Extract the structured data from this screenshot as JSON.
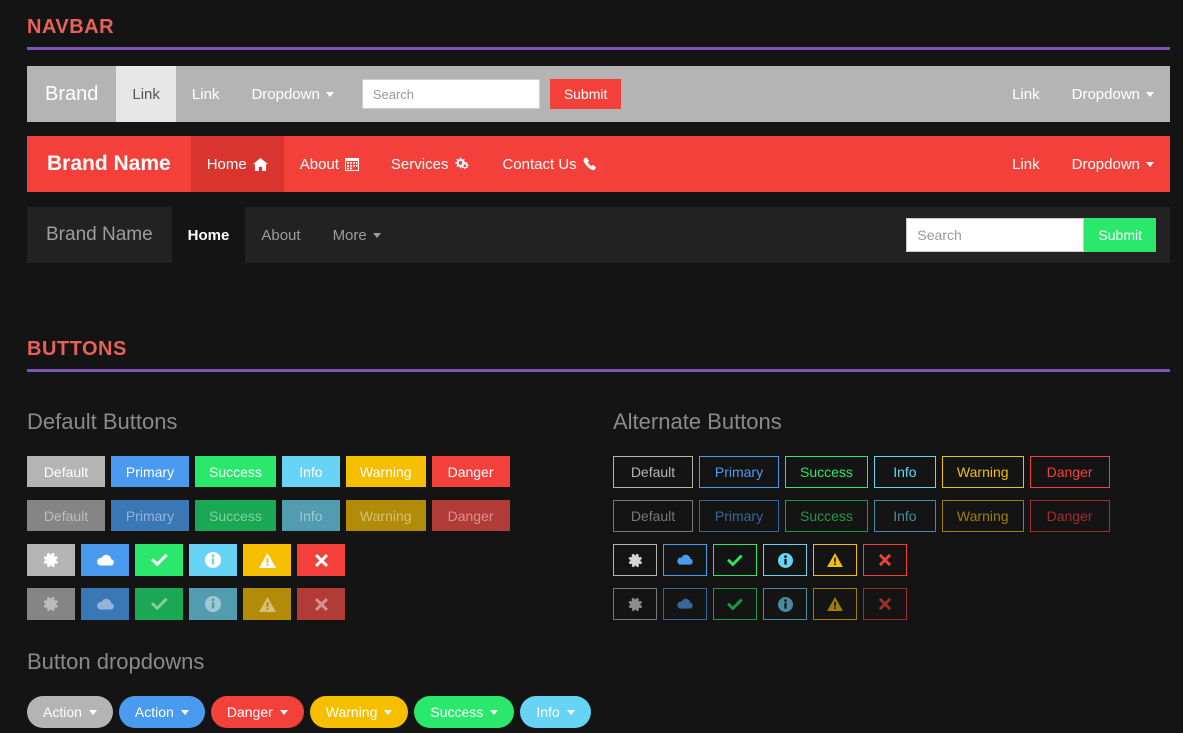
{
  "sections": {
    "navbar": {
      "title": "NAVBAR",
      "rule_color": "#7b55b5",
      "title_color": "#e8615a"
    },
    "buttons": {
      "title": "BUTTONS",
      "rule_color": "#7b55b5",
      "title_color": "#e8615a"
    }
  },
  "navbars": [
    {
      "style": "gray",
      "brand": "Brand",
      "left_items": [
        {
          "label": "Link",
          "active": true,
          "caret": false
        },
        {
          "label": "Link",
          "active": false,
          "caret": false
        },
        {
          "label": "Dropdown",
          "active": false,
          "caret": true
        }
      ],
      "search": {
        "placeholder": "Search",
        "value": ""
      },
      "submit_label": "Submit",
      "submit_color": "#f3403a",
      "right_items": [
        {
          "label": "Link",
          "caret": false
        },
        {
          "label": "Dropdown",
          "caret": true
        }
      ]
    },
    {
      "style": "red",
      "brand": "Brand Name",
      "left_items": [
        {
          "label": "Home",
          "active": true,
          "icon": "home-icon"
        },
        {
          "label": "About",
          "active": false,
          "icon": "calendar-icon"
        },
        {
          "label": "Services",
          "active": false,
          "icon": "gears-icon"
        },
        {
          "label": "Contact Us",
          "active": false,
          "icon": "phone-icon"
        }
      ],
      "right_items": [
        {
          "label": "Link",
          "caret": false
        },
        {
          "label": "Dropdown",
          "caret": true
        }
      ]
    },
    {
      "style": "dark",
      "brand": "Brand Name",
      "left_items": [
        {
          "label": "Home",
          "active": true,
          "caret": false
        },
        {
          "label": "About",
          "active": false,
          "caret": false
        },
        {
          "label": "More",
          "active": false,
          "caret": true
        }
      ],
      "search": {
        "placeholder": "Search",
        "value": ""
      },
      "submit_label": "Submit",
      "submit_color": "#2ae86b"
    }
  ],
  "buttons": {
    "default_heading": "Default Buttons",
    "alternate_heading": "Alternate Buttons",
    "dropdown_heading": "Button dropdowns",
    "solid_row": [
      {
        "label": "Default",
        "bg": "#b4b4b4"
      },
      {
        "label": "Primary",
        "bg": "#4a9bf0"
      },
      {
        "label": "Success",
        "bg": "#2ae86b"
      },
      {
        "label": "Info",
        "bg": "#68d4f5"
      },
      {
        "label": "Warning",
        "bg": "#f5bf00"
      },
      {
        "label": "Danger",
        "bg": "#f3403a"
      }
    ],
    "solid_row_muted": [
      {
        "label": "Default",
        "bg": "#858585"
      },
      {
        "label": "Primary",
        "bg": "#3a77b5"
      },
      {
        "label": "Success",
        "bg": "#1aa854"
      },
      {
        "label": "Info",
        "bg": "#529cb0"
      },
      {
        "label": "Warning",
        "bg": "#b28c08"
      },
      {
        "label": "Danger",
        "bg": "#b13b37"
      }
    ],
    "icon_row": [
      {
        "icon": "gear-icon",
        "bg": "#b4b4b4"
      },
      {
        "icon": "cloud-icon",
        "bg": "#4a9bf0"
      },
      {
        "icon": "check-icon",
        "bg": "#2ae86b"
      },
      {
        "icon": "info-icon",
        "bg": "#68d4f5"
      },
      {
        "icon": "warning-icon",
        "bg": "#f5bf00"
      },
      {
        "icon": "close-icon",
        "bg": "#f3403a"
      }
    ],
    "icon_row_muted": [
      {
        "icon": "gear-icon",
        "bg": "#858585"
      },
      {
        "icon": "cloud-icon",
        "bg": "#3a77b5"
      },
      {
        "icon": "check-icon",
        "bg": "#1aa854"
      },
      {
        "icon": "info-icon",
        "bg": "#529cb0"
      },
      {
        "icon": "warning-icon",
        "bg": "#b28c08"
      },
      {
        "icon": "close-icon",
        "bg": "#b13b37"
      }
    ],
    "outline_row": [
      {
        "label": "Default",
        "color": "#b4b4b4"
      },
      {
        "label": "Primary",
        "color": "#4a9bf0"
      },
      {
        "label": "Success",
        "color": "#2ae86b"
      },
      {
        "label": "Info",
        "color": "#68d4f5"
      },
      {
        "label": "Warning",
        "color": "#f5bf00"
      },
      {
        "label": "Danger",
        "color": "#f3403a"
      }
    ],
    "outline_row_muted": [
      {
        "label": "Default",
        "color": "#b4b4b4"
      },
      {
        "label": "Primary",
        "color": "#4a9bf0"
      },
      {
        "label": "Success",
        "color": "#2ae86b"
      },
      {
        "label": "Info",
        "color": "#68d4f5"
      },
      {
        "label": "Warning",
        "color": "#f5bf00"
      },
      {
        "label": "Danger",
        "color": "#f3403a"
      }
    ],
    "outline_icon_row": [
      {
        "icon": "gear-icon",
        "color": "#b4b4b4"
      },
      {
        "icon": "cloud-icon",
        "color": "#4a9bf0"
      },
      {
        "icon": "check-icon",
        "color": "#2ae86b"
      },
      {
        "icon": "info-icon",
        "color": "#68d4f5"
      },
      {
        "icon": "warning-icon",
        "color": "#f5bf00"
      },
      {
        "icon": "close-icon",
        "color": "#f3403a"
      }
    ],
    "outline_icon_row_muted": [
      {
        "icon": "gear-icon",
        "color": "#b4b4b4"
      },
      {
        "icon": "cloud-icon",
        "color": "#4a9bf0"
      },
      {
        "icon": "check-icon",
        "color": "#2ae86b"
      },
      {
        "icon": "info-icon",
        "color": "#68d4f5"
      },
      {
        "icon": "warning-icon",
        "color": "#f5bf00"
      },
      {
        "icon": "close-icon",
        "color": "#f3403a"
      }
    ],
    "dropdowns": [
      {
        "label": "Action",
        "bg": "#b4b4b4"
      },
      {
        "label": "Action",
        "bg": "#4a9bf0"
      },
      {
        "label": "Danger",
        "bg": "#f3403a"
      },
      {
        "label": "Warning",
        "bg": "#f5bf00"
      },
      {
        "label": "Success",
        "bg": "#2ae86b"
      },
      {
        "label": "Info",
        "bg": "#68d4f5"
      }
    ]
  }
}
